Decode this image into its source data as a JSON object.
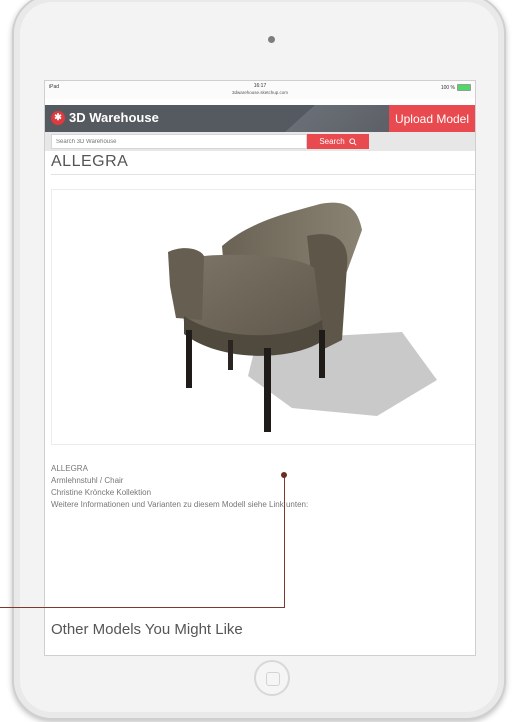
{
  "statusbar": {
    "carrier": "iPad",
    "time": "16:17",
    "url": "3dwarehouse.sketchup.com",
    "battery": "100 %"
  },
  "header": {
    "logo_text": "3D Warehouse",
    "upload_label": "Upload Model",
    "brand_color": "#e84a4f"
  },
  "search": {
    "placeholder": "Search 3D Warehouse",
    "button_label": "Search"
  },
  "model": {
    "title": "ALLEGRA",
    "description_lines": [
      "ALLEGRA",
      "Armlehnstuhl / Chair",
      "Christine Kröncke Kollektion",
      "Weitere Informationen und Varianten zu diesem Modell siehe Link unten:"
    ]
  },
  "related": {
    "title": "Other Models You Might Like"
  },
  "icons": {
    "search": "search-icon",
    "logo": "warehouse-logo-icon",
    "camera": "camera-icon",
    "home": "home-button-icon"
  }
}
